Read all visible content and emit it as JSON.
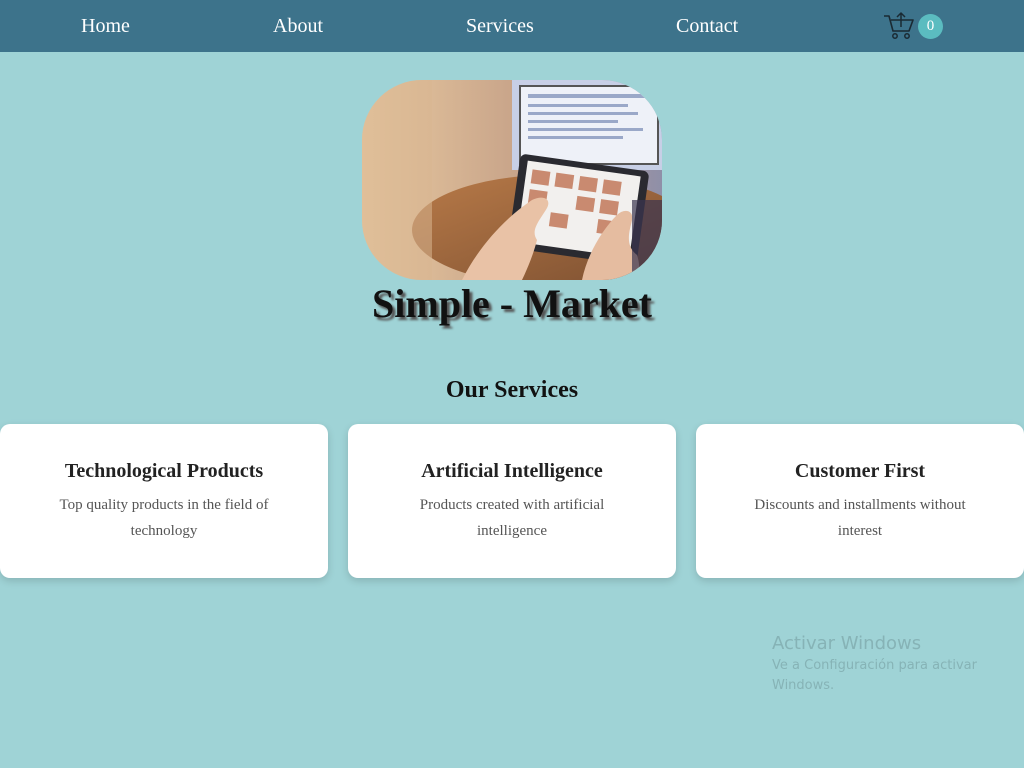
{
  "nav": {
    "items": [
      {
        "label": "Home"
      },
      {
        "label": "About"
      },
      {
        "label": "Services"
      },
      {
        "label": "Contact"
      }
    ],
    "cart_icon": "shopping-cart-icon",
    "cart_count": "0"
  },
  "hero": {
    "image_icon": "tablet-shopping-photo"
  },
  "site_title": "Simple - Market",
  "services": {
    "title": "Our Services",
    "cards": [
      {
        "title": "Technological Products",
        "description": "Top quality products in the field of technology"
      },
      {
        "title": "Artificial Intelligence",
        "description": "Products created with artificial intelligence"
      },
      {
        "title": "Customer First",
        "description": "Discounts and installments without interest"
      }
    ]
  },
  "watermark": {
    "title": "Activar Windows",
    "subtitle": "Ve a Configuración para activar Windows."
  },
  "colors": {
    "page_bg": "#9fd3d6",
    "navbar_bg": "#3d738b",
    "badge_bg": "#5bbcc0",
    "card_bg": "#ffffff"
  }
}
